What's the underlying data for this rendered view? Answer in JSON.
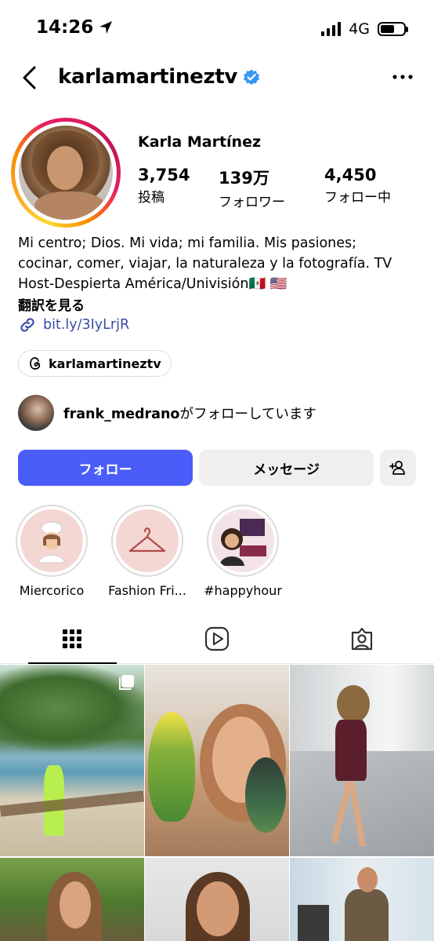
{
  "status": {
    "time": "14:26",
    "network": "4G"
  },
  "header": {
    "username": "karlamartineztv"
  },
  "profile": {
    "display_name": "Karla Martínez",
    "stats": [
      {
        "value": "3,754",
        "label": "投稿"
      },
      {
        "value": "139万",
        "label": "フォロワー"
      },
      {
        "value": "4,450",
        "label": "フォロー中"
      }
    ],
    "bio_lines": [
      "Mi centro; Dios. Mi vida; mi familia. Mis pasiones;",
      "cocinar, comer, viajar, la naturaleza y la fotografía. TV",
      "Host-Despierta América/Univisión🇲🇽 🇺🇸"
    ],
    "translate": "翻訳を見る",
    "link": "bit.ly/3IyLrjR",
    "threads": "karlamartineztv"
  },
  "followed_by": {
    "name": "frank_medrano",
    "suffix": "がフォローしています"
  },
  "actions": {
    "follow": "フォロー",
    "message": "メッセージ"
  },
  "highlights": [
    {
      "label": "Miercorico",
      "bg": "#f4d6d2"
    },
    {
      "label": "Fashion Fri...",
      "bg": "#f4d6d2"
    },
    {
      "label": "#happyhour",
      "bg": "#f3e3e6"
    }
  ],
  "colors": {
    "accent": "#4a5df9",
    "verified": "#3897f0",
    "link": "#3b4ba8"
  }
}
